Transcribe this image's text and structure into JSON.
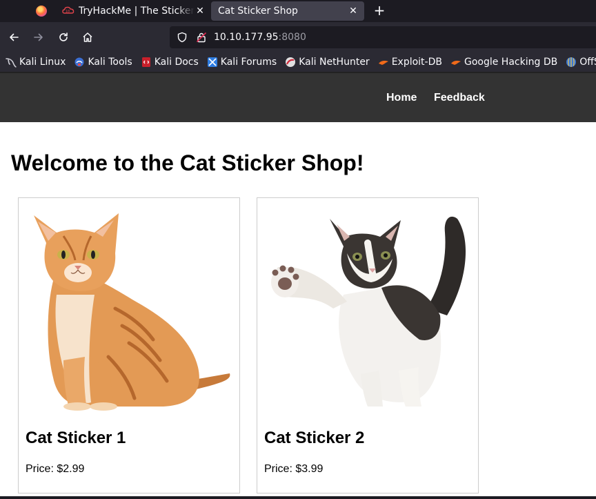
{
  "browser": {
    "tabs": [
      {
        "title": "TryHackMe | The Sticker Shop",
        "active": false
      },
      {
        "title": "Cat Sticker Shop",
        "active": true
      }
    ],
    "url": {
      "host": "10.10.177.95",
      "port": ":8080"
    },
    "bookmarks": [
      {
        "label": "Kali Linux",
        "icon": "kali-dragon-icon"
      },
      {
        "label": "Kali Tools",
        "icon": "kali-tools-icon"
      },
      {
        "label": "Kali Docs",
        "icon": "kali-docs-icon"
      },
      {
        "label": "Kali Forums",
        "icon": "kali-forums-icon"
      },
      {
        "label": "Kali NetHunter",
        "icon": "nethunter-icon"
      },
      {
        "label": "Exploit-DB",
        "icon": "exploit-db-icon"
      },
      {
        "label": "Google Hacking DB",
        "icon": "ghdb-icon"
      },
      {
        "label": "OffSec",
        "icon": "offsec-icon"
      }
    ]
  },
  "site": {
    "nav": {
      "home": "Home",
      "feedback": "Feedback"
    },
    "heading": "Welcome to the Cat Sticker Shop!",
    "products": [
      {
        "title": "Cat Sticker 1",
        "price": "Price: $2.99",
        "image": "orange-tabby-cat"
      },
      {
        "title": "Cat Sticker 2",
        "price": "Price: $3.99",
        "image": "calico-kitten-waving"
      }
    ]
  },
  "colors": {
    "chrome_dark": "#1c1b22",
    "chrome_toolbar": "#2b2a33",
    "tab_active": "#42414d",
    "site_header": "#333333"
  }
}
